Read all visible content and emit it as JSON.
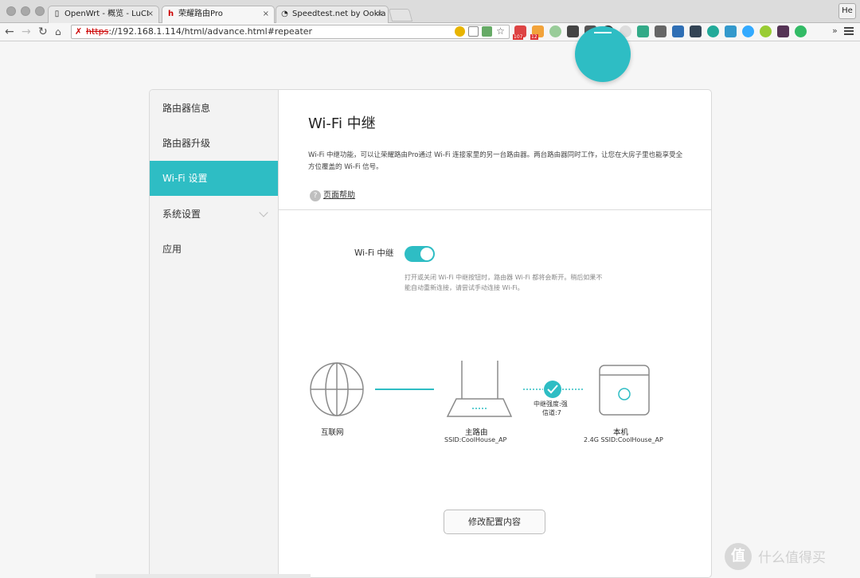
{
  "browser": {
    "tabs": [
      {
        "title": "OpenWrt - 概览 - LuCI",
        "active": false,
        "icon": "page-icon"
      },
      {
        "title": "荣耀路由Pro",
        "active": true,
        "icon": "honor-h-icon"
      },
      {
        "title": "Speedtest.net by Ookla - T",
        "active": false,
        "icon": "speedtest-gauge-icon"
      }
    ],
    "close_glyph": "×",
    "profile_label": "He",
    "url_scheme": "https",
    "url_rest": "://192.168.1.114/html/advance.html#repeater",
    "ext_badges": {
      "gmail": "107",
      "calendar": "12"
    },
    "more_glyph": "»"
  },
  "sidebar": {
    "items": [
      {
        "label": "路由器信息"
      },
      {
        "label": "路由器升级"
      },
      {
        "label": "Wi-Fi 设置"
      },
      {
        "label": "系统设置"
      },
      {
        "label": "应用"
      }
    ],
    "active_index": 2
  },
  "main": {
    "title": "Wi-Fi 中继",
    "description": "Wi-Fi 中继功能，可以让荣耀路由Pro通过 Wi-Fi 连接家里的另一台路由器。两台路由器同时工作，让您在大房子里也能享受全方位覆盖的 Wi-Fi 信号。",
    "help_label": "页面帮助",
    "help_icon": "?",
    "toggle": {
      "label": "Wi-Fi 中继",
      "on": true
    },
    "hint": "打开或关闭 Wi-Fi 中继按钮时，路由器 Wi-Fi 都将会断开。稍后如果不能自动重新连接，请尝试手动连接 Wi-Fi。",
    "diagram": {
      "internet": {
        "label": "互联网"
      },
      "main_router": {
        "label": "主路由",
        "ssid": "SSID:CoolHouse_AP"
      },
      "relay": {
        "strength": "中继强度:强",
        "channel": "信道:7"
      },
      "this_device": {
        "label": "本机",
        "ssid": "2.4G SSID:CoolHouse_AP"
      }
    },
    "edit_button": "修改配置内容"
  },
  "watermark": {
    "icon_text": "值",
    "text": "什么值得买"
  },
  "colors": {
    "accent": "#2ebdc4"
  }
}
